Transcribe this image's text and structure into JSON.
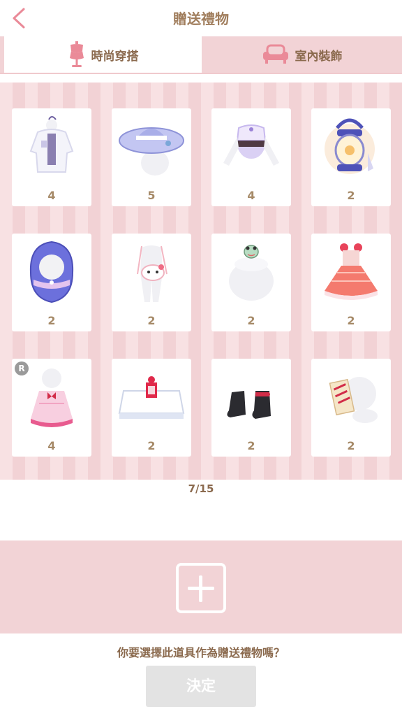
{
  "header": {
    "title": "贈送禮物"
  },
  "tabs": [
    {
      "label": "時尚穿搭",
      "icon": "mannequin-icon",
      "active": true
    },
    {
      "label": "室內裝飾",
      "icon": "sofa-icon",
      "active": false
    }
  ],
  "items": [
    {
      "name": "white-lace-coat",
      "quantity": "4"
    },
    {
      "name": "lavender-sun-hat",
      "quantity": "5"
    },
    {
      "name": "lavender-lace-top",
      "quantity": "4"
    },
    {
      "name": "purple-lantern",
      "quantity": "2"
    },
    {
      "name": "purple-hood",
      "quantity": "2"
    },
    {
      "name": "kitty-bag-outfit",
      "quantity": "2"
    },
    {
      "name": "frog-hat",
      "quantity": "2"
    },
    {
      "name": "red-plaid-dress",
      "quantity": "2"
    },
    {
      "name": "pink-ribbon-dress",
      "quantity": "4",
      "badge": "R"
    },
    {
      "name": "white-gift-box",
      "quantity": "2"
    },
    {
      "name": "black-boots",
      "quantity": "2"
    },
    {
      "name": "charm-mask",
      "quantity": "2"
    }
  ],
  "pagination": {
    "text": "7/15"
  },
  "gift_slot": {
    "icon": "plus-icon"
  },
  "prompt": {
    "text": "你要選擇此道具作為贈送禮物嗎？"
  },
  "confirm": {
    "label": "決定"
  },
  "colors": {
    "accent": "#f2d3d6",
    "text": "#a07d5c",
    "icon": "#ea8a98",
    "disabled": "#e3e3e3"
  }
}
